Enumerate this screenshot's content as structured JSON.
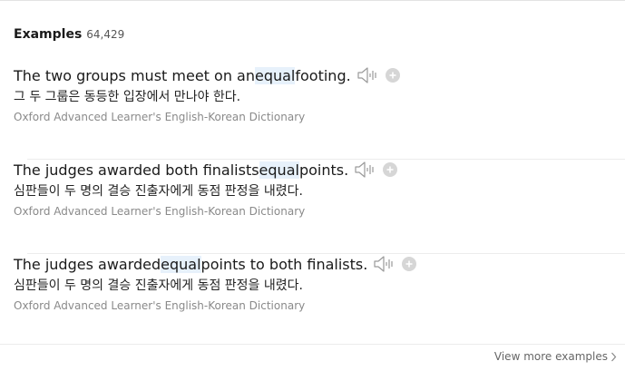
{
  "examples": {
    "title": "Examples",
    "count": "64,429",
    "items": [
      {
        "before": "The two groups must meet on an ",
        "highlight": "equal",
        "after": " footing.",
        "translation": "그 두 그룹은 동등한 입장에서 만나야 한다.",
        "source": "Oxford Advanced Learner's English-Korean Dictionary"
      },
      {
        "before": "The judges awarded both finalists ",
        "highlight": "equal",
        "after": " points.",
        "translation": "심판들이 두 명의 결승 진출자에게 동점 판정을 내렸다.",
        "source": "Oxford Advanced Learner's English-Korean Dictionary"
      },
      {
        "before": "The judges awarded ",
        "highlight": "equal",
        "after": " points to both finalists.",
        "translation": "심판들이 두 명의 결승 진출자에게 동점 판정을 내렸다.",
        "source": "Oxford Advanced Learner's English-Korean Dictionary"
      }
    ]
  },
  "footer": {
    "view_more_label": "View more examples"
  },
  "icons": {
    "speaker": "speaker-icon",
    "add": "plus-circle-icon",
    "more": "chevron-right-icon"
  },
  "colors": {
    "highlight": "#e7f1fb",
    "source_text": "#8a8a8a",
    "icon": "#9a9a9a"
  }
}
